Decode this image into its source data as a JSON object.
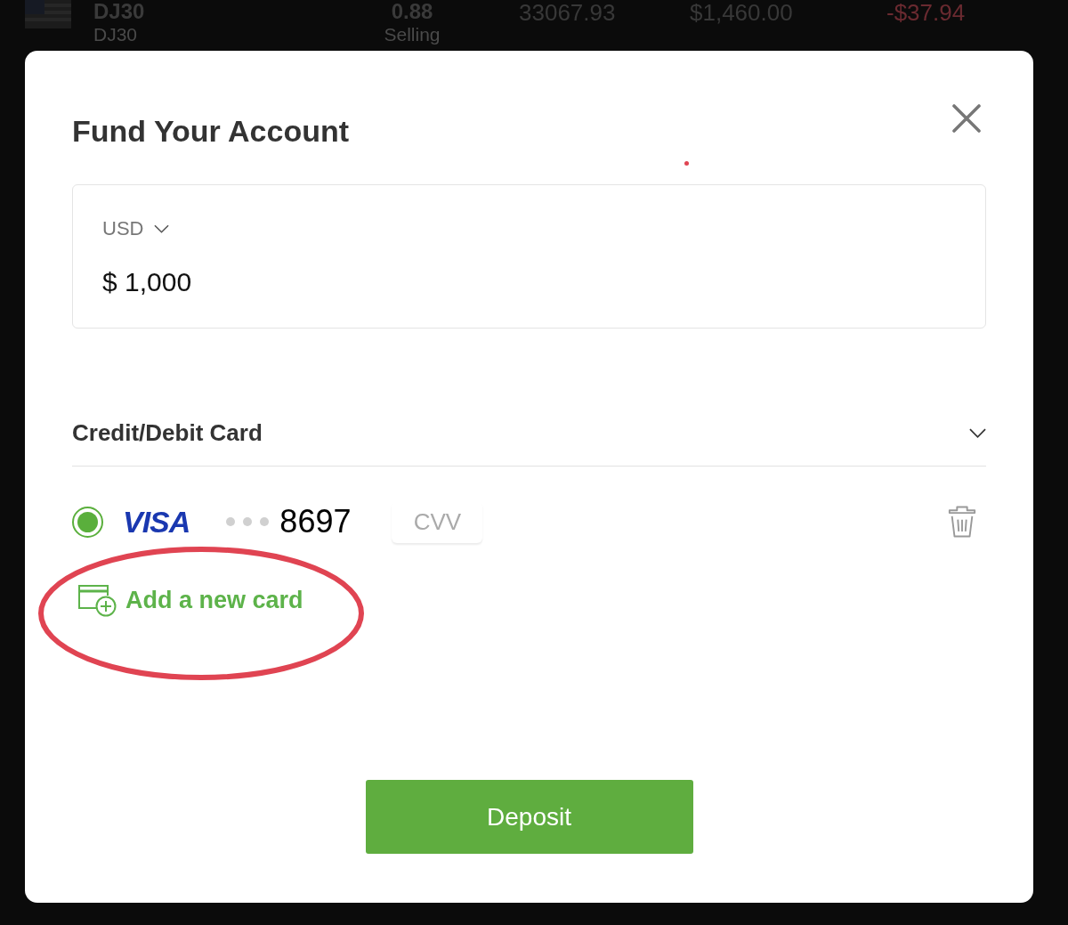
{
  "background_row": {
    "instrument": {
      "symbol": "DJ30",
      "subtitle": "DJ30"
    },
    "rate": {
      "value": "0.88",
      "side": "Selling"
    },
    "cells": [
      {
        "text": "33067.93",
        "kind": "plain"
      },
      {
        "text": "$1,460.00",
        "kind": "plain"
      },
      {
        "text": "-$37.94",
        "kind": "loss"
      }
    ]
  },
  "dialog": {
    "title": "Fund Your Account",
    "mark": {
      "kind": "dot"
    },
    "amount": {
      "currency": "USD",
      "value": "$ 1,000"
    },
    "payment_method": {
      "title": "Credit/Debit Card",
      "cards": [
        {
          "brand": "VISA",
          "last4": "8697",
          "selected": true,
          "cvv_placeholder": "CVV"
        }
      ],
      "add_card": {
        "label": "Add a new card",
        "annotation": {
          "kind": "ellipse"
        }
      }
    },
    "submit": "Deposit"
  }
}
